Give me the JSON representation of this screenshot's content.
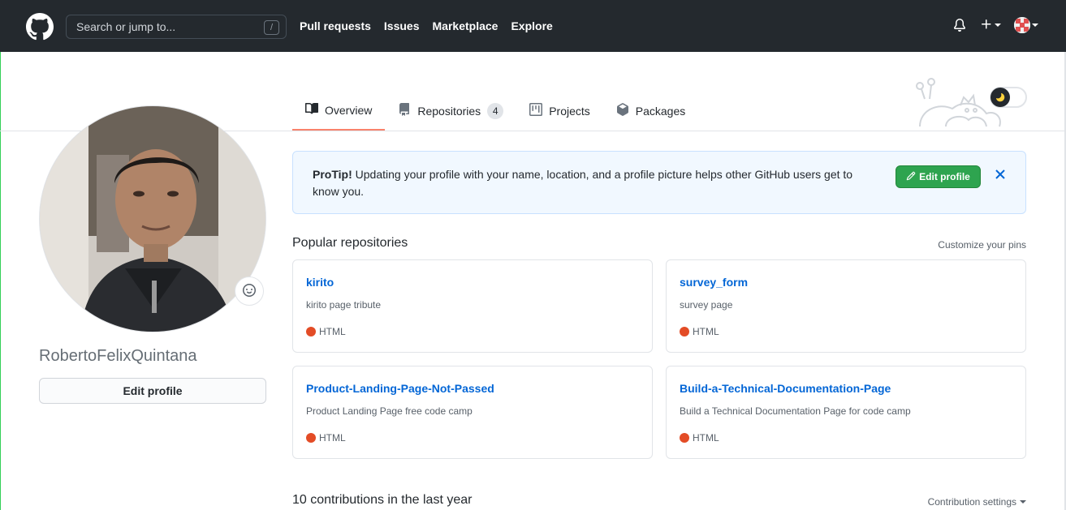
{
  "header": {
    "search_placeholder": "Search or jump to...",
    "search_shortcut": "/",
    "nav": [
      "Pull requests",
      "Issues",
      "Marketplace",
      "Explore"
    ]
  },
  "tabs": [
    {
      "label": "Overview",
      "active": true
    },
    {
      "label": "Repositories",
      "count": "4"
    },
    {
      "label": "Projects"
    },
    {
      "label": "Packages"
    }
  ],
  "profile": {
    "username": "RobertoFelixQuintana",
    "edit_button": "Edit profile"
  },
  "protip": {
    "lead": "ProTip!",
    "text": " Updating your profile with your name, location, and a profile picture helps other GitHub users get to know you.",
    "button": "Edit profile"
  },
  "popular": {
    "title": "Popular repositories",
    "customize": "Customize your pins",
    "repos": [
      {
        "name": "kirito",
        "desc": "kirito page tribute",
        "lang": "HTML"
      },
      {
        "name": "survey_form",
        "desc": "survey page",
        "lang": "HTML"
      },
      {
        "name": "Product-Landing-Page-Not-Passed",
        "desc": "Product Landing Page free code camp",
        "lang": "HTML"
      },
      {
        "name": "Build-a-Technical-Documentation-Page",
        "desc": "Build a Technical Documentation Page for code camp",
        "lang": "HTML"
      }
    ]
  },
  "contributions": {
    "title": "10 contributions in the last year",
    "settings": "Contribution settings"
  },
  "colors": {
    "header_bg": "#24292e",
    "link": "#0366d6",
    "html_lang": "#e34c26",
    "green_button": "#2ea44f",
    "tab_underline": "#f9826c"
  }
}
